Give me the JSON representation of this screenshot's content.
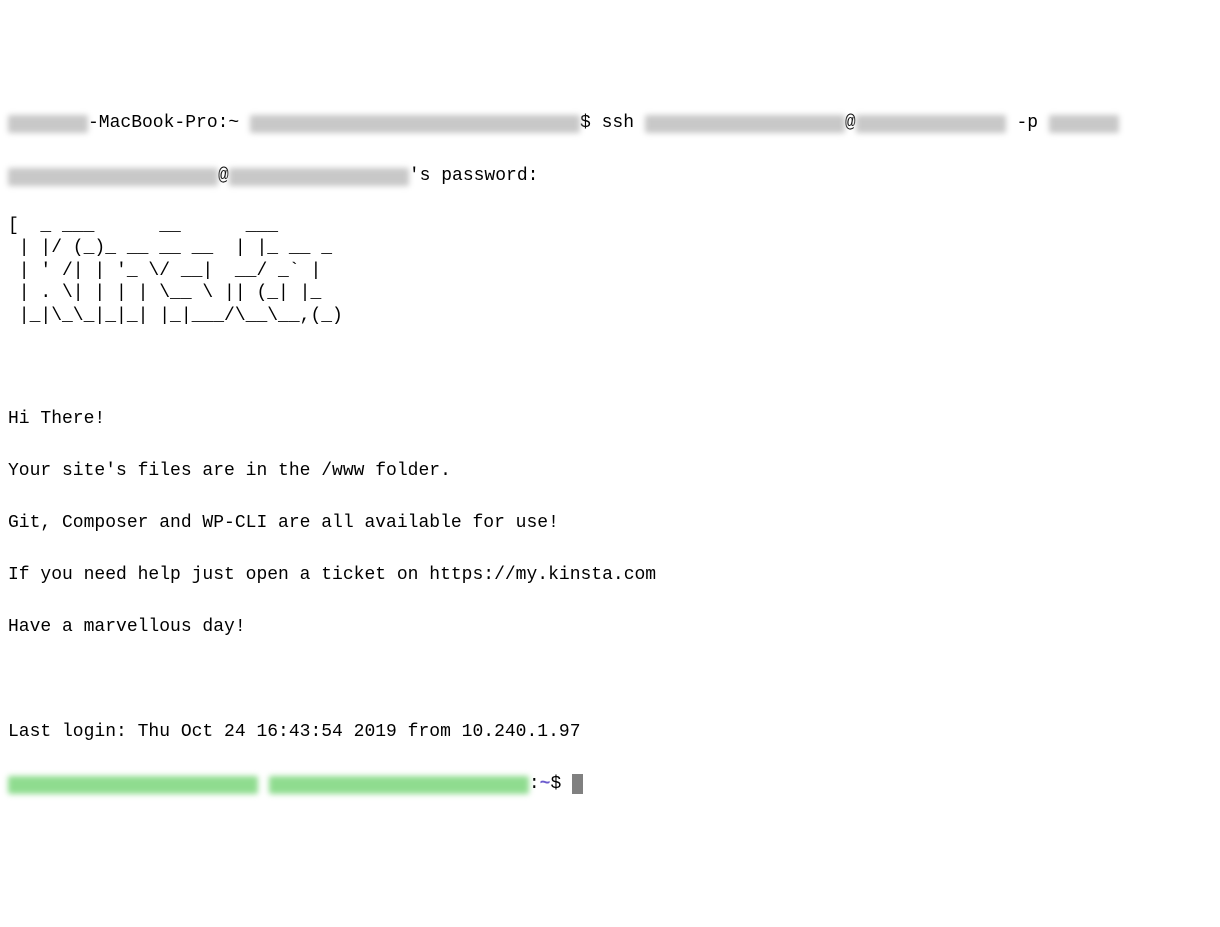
{
  "prompt1": {
    "hostname_visible": "-MacBook-Pro:~ ",
    "after_user": "$ ssh ",
    "at": "@",
    "p_flag": " -p "
  },
  "prompt2": {
    "at": "@",
    "suffix": "'s password:"
  },
  "ascii_art": "[  _ ___      __      ___\n | |/ (_)_ __ __ __  | |_ __ _\n | ' /| | '_ \\/ __|  __/ _` |\n | . \\| | | | \\__ \\ || (_| |_\n |_|\\_\\_|_|_| |_|___/\\__\\__,(_)",
  "motd": {
    "line1": "Hi There!",
    "line2": "Your site's files are in the /www folder.",
    "line3": "Git, Composer and WP-CLI are all available for use!",
    "line4": "If you need help just open a ticket on https://my.kinsta.com",
    "line5": "Have a marvellous day!"
  },
  "last_login": "Last login: Thu Oct 24 16:43:54 2019 from 10.240.1.97",
  "shell_prompt": {
    "sep": ":",
    "tilde": "~",
    "dollar": "$ "
  }
}
